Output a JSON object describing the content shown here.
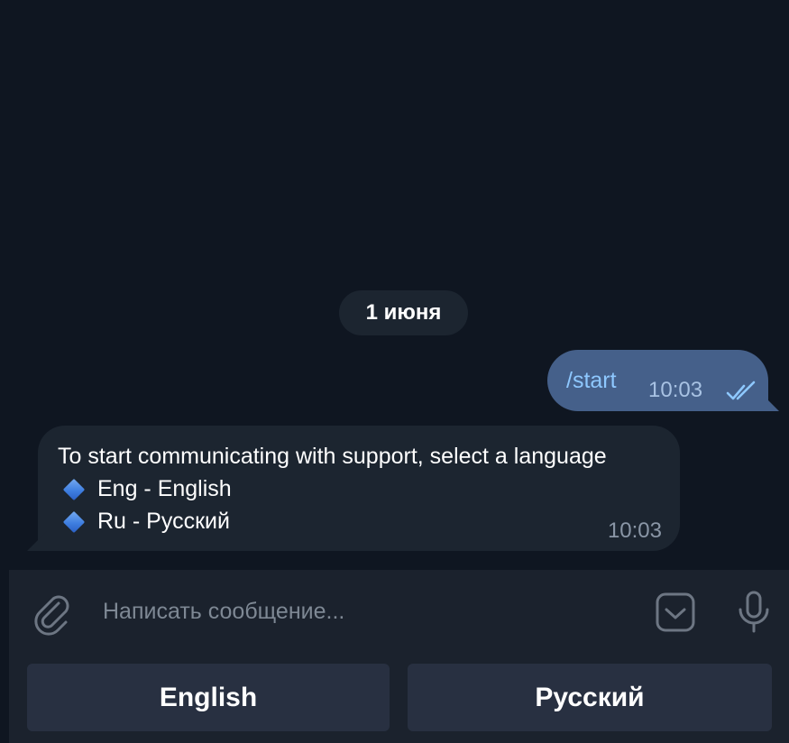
{
  "chat": {
    "date_label": "1 июня",
    "outgoing": {
      "text": "/start",
      "time": "10:03",
      "status": "read"
    },
    "incoming": {
      "line1": "To start communicating with support, select a language",
      "line2": "Eng - English",
      "line3": "Ru - Русский",
      "bullet_icon": "blue-diamond-icon",
      "time": "10:03"
    }
  },
  "composer": {
    "placeholder": "Написать сообщение...",
    "attach_icon": "paperclip-icon",
    "sticker_icon": "sticker-icon",
    "mic_icon": "microphone-icon"
  },
  "keyboard": {
    "buttons": [
      {
        "label": "English"
      },
      {
        "label": "Русский"
      }
    ]
  },
  "colors": {
    "background": "#0f1621",
    "bubble_in": "#1c2530",
    "bubble_out": "#45608a",
    "command_text": "#8ec8ff",
    "button_bg": "#283041"
  }
}
